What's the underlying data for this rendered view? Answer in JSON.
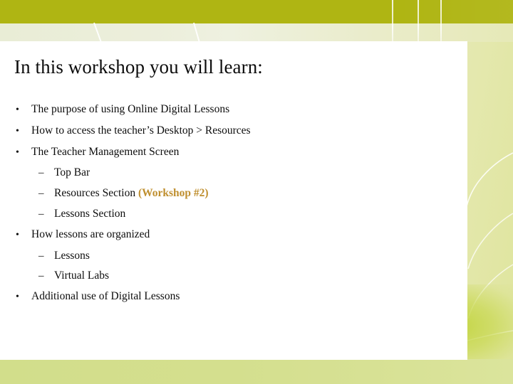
{
  "slide": {
    "title": "In this workshop you will learn:",
    "colors": {
      "top_band": "#afb513",
      "pale_band": "#eceedb",
      "bottom_band": "#d2de8b",
      "right_wash": "#e6e9b4",
      "accent_text": "#bf8f2f",
      "body_text": "#0d0d0d",
      "card": "#ffffff"
    },
    "bullets": [
      {
        "level": 1,
        "marker": "•",
        "text": "The purpose of using Online Digital Lessons",
        "accent": ""
      },
      {
        "level": 1,
        "marker": "•",
        "text": "How to access the teacher’s Desktop > Resources",
        "accent": ""
      },
      {
        "level": 1,
        "marker": "•",
        "text": "The Teacher Management Screen",
        "accent": ""
      },
      {
        "level": 2,
        "marker": "–",
        "text": "Top Bar",
        "accent": ""
      },
      {
        "level": 2,
        "marker": "–",
        "text": "Resources Section ",
        "accent": "(Workshop #2)"
      },
      {
        "level": 2,
        "marker": "–",
        "text": "Lessons Section",
        "accent": ""
      },
      {
        "level": 1,
        "marker": "•",
        "text": "How lessons are organized",
        "accent": ""
      },
      {
        "level": 2,
        "marker": "–",
        "text": "Lessons",
        "accent": ""
      },
      {
        "level": 2,
        "marker": "–",
        "text": "Virtual Labs",
        "accent": ""
      },
      {
        "level": 1,
        "marker": "•",
        "text": "Additional use of Digital Lessons",
        "accent": ""
      }
    ]
  }
}
